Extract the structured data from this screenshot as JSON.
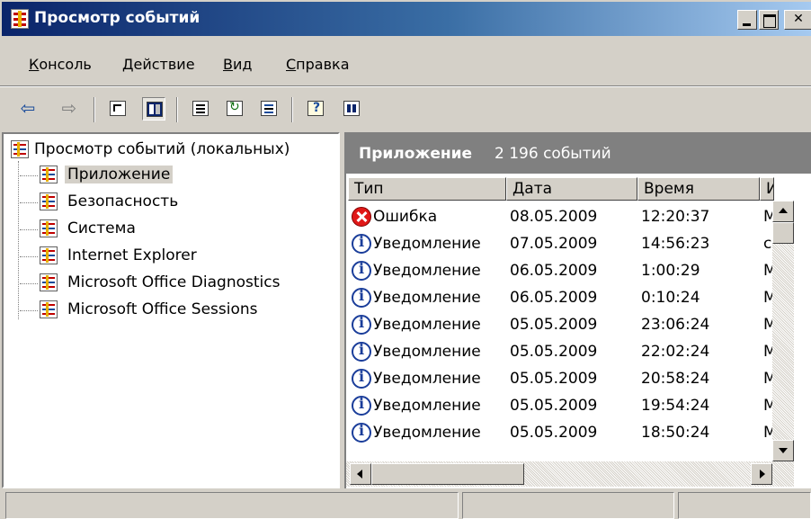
{
  "window": {
    "title": "Просмотр событий"
  },
  "menu": [
    {
      "first": "К",
      "rest": "онсоль"
    },
    {
      "first": "Д",
      "rest": "ействие"
    },
    {
      "first": "В",
      "rest": "ид"
    },
    {
      "first": "С",
      "rest": "правка"
    }
  ],
  "toolbar": {
    "icons": [
      "back-arrow-icon",
      "forward-arrow-icon",
      "up-level-icon",
      "show-hide-tree-icon",
      "properties-icon",
      "refresh-icon",
      "export-list-icon",
      "help-icon",
      "show-hide-action-pane-icon"
    ],
    "back": "⇦",
    "forward": "⇨"
  },
  "tree": {
    "root": "Просмотр событий (локальных)",
    "items": [
      "Приложение",
      "Безопасность",
      "Система",
      "Internet Explorer",
      "Microsoft Office Diagnostics",
      "Microsoft Office Sessions"
    ],
    "selected": "Приложение"
  },
  "pane": {
    "title": "Приложение",
    "count": "2 196 событий"
  },
  "columns": [
    "Тип",
    "Дата",
    "Время",
    "Ис"
  ],
  "rows": [
    {
      "type": "Ошибка",
      "icon": "error-icon",
      "date": "08.05.2009",
      "time": "12:20:37",
      "source": "Mi"
    },
    {
      "type": "Уведомление",
      "icon": "info-icon",
      "date": "07.05.2009",
      "time": "14:56:23",
      "source": "cr"
    },
    {
      "type": "Уведомление",
      "icon": "info-icon",
      "date": "06.05.2009",
      "time": "1:00:29",
      "source": "MS"
    },
    {
      "type": "Уведомление",
      "icon": "info-icon",
      "date": "06.05.2009",
      "time": "0:10:24",
      "source": "MS"
    },
    {
      "type": "Уведомление",
      "icon": "info-icon",
      "date": "05.05.2009",
      "time": "23:06:24",
      "source": "MS"
    },
    {
      "type": "Уведомление",
      "icon": "info-icon",
      "date": "05.05.2009",
      "time": "22:02:24",
      "source": "MS"
    },
    {
      "type": "Уведомление",
      "icon": "info-icon",
      "date": "05.05.2009",
      "time": "20:58:24",
      "source": "MS"
    },
    {
      "type": "Уведомление",
      "icon": "info-icon",
      "date": "05.05.2009",
      "time": "19:54:24",
      "source": "MS"
    },
    {
      "type": "Уведомление",
      "icon": "info-icon",
      "date": "05.05.2009",
      "time": "18:50:24",
      "source": "MS"
    }
  ],
  "colors": {
    "title_start": "#0a246a",
    "title_end": "#a6caf0",
    "pane_header": "#808080",
    "face": "#d4d0c8",
    "error": "#e01818",
    "info": "#1a3d9a"
  }
}
